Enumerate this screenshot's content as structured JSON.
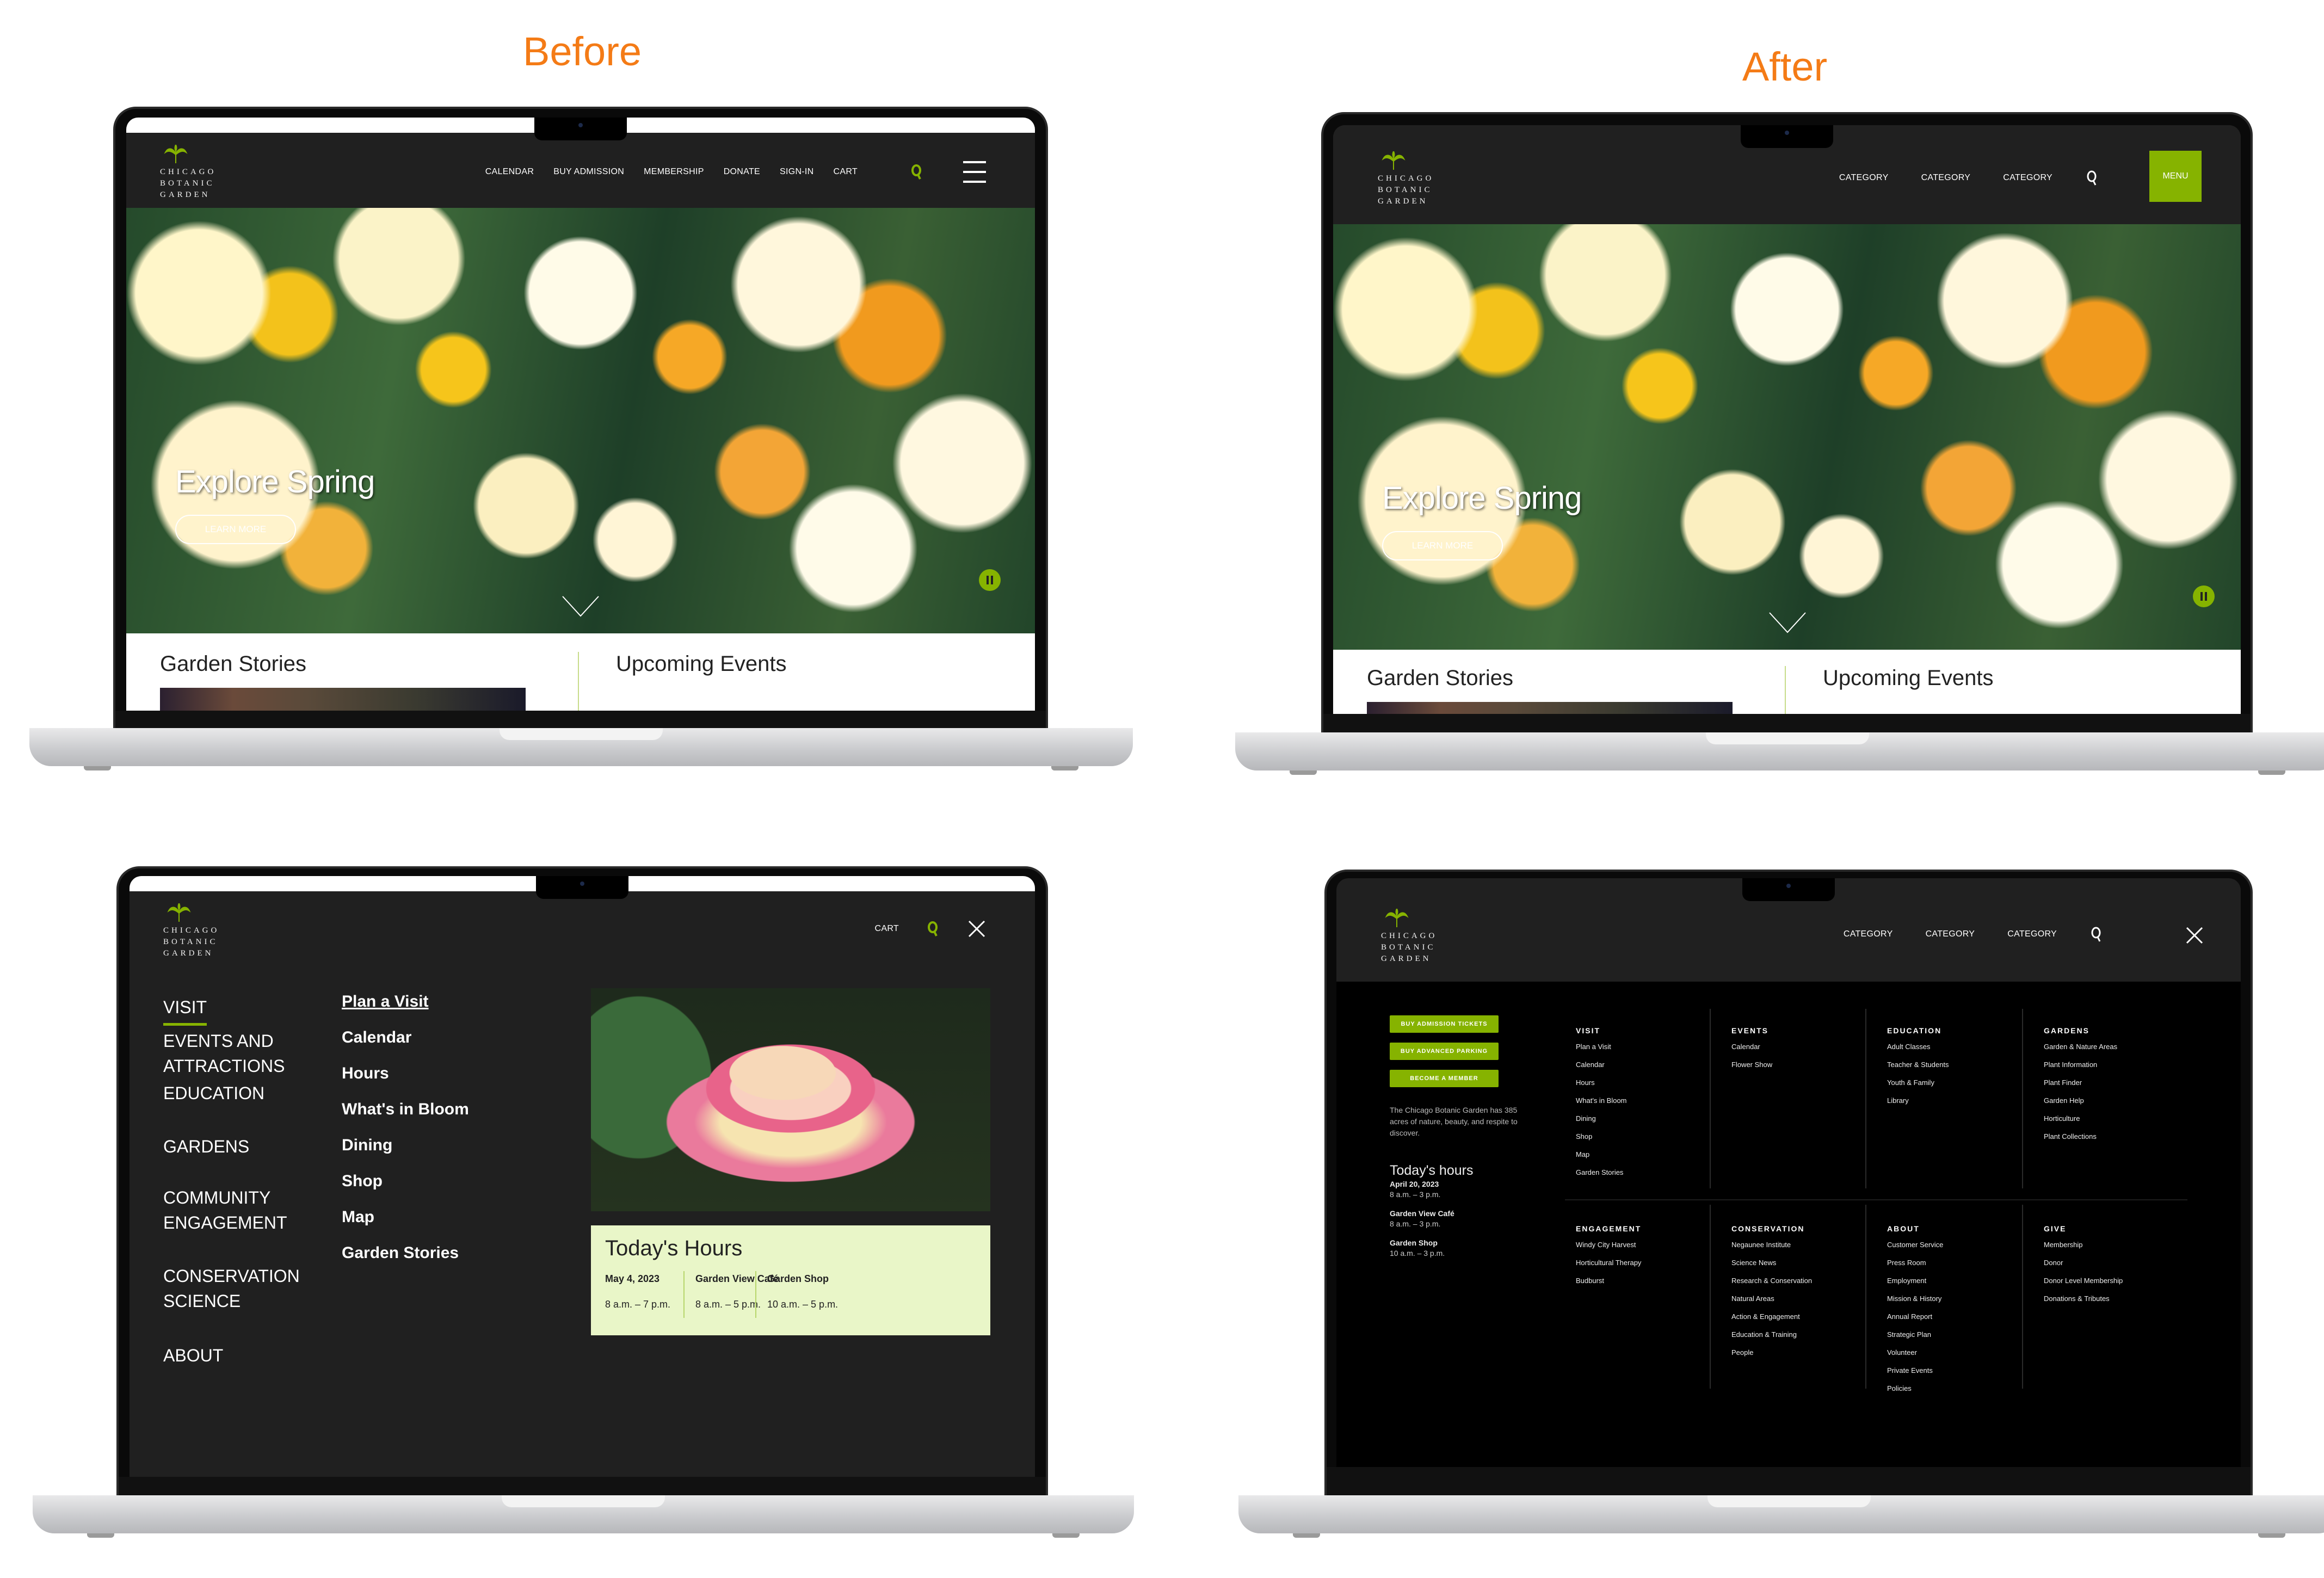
{
  "labels": {
    "before": "Before",
    "after": "After"
  },
  "brand": {
    "line1": "CHICAGO",
    "line2": "BOTANIC",
    "line3": "GARDEN",
    "accent": "#86b300",
    "label_color": "#f47b16"
  },
  "before_home": {
    "nav": [
      "CALENDAR",
      "BUY ADMISSION",
      "MEMBERSHIP",
      "DONATE",
      "SIGN-IN",
      "CART"
    ],
    "hero_title": "Explore Spring",
    "hero_button": "LEARN MORE",
    "section_left": "Garden Stories",
    "section_right": "Upcoming Events"
  },
  "after_home": {
    "nav": [
      "CATEGORY",
      "CATEGORY",
      "CATEGORY"
    ],
    "menu_button": "MENU",
    "hero_title": "Explore Spring",
    "hero_button": "LEARN MORE",
    "section_left": "Garden Stories",
    "section_right": "Upcoming Events"
  },
  "before_menu": {
    "cart": "CART",
    "primary": [
      "VISIT",
      "EVENTS AND\nATTRACTIONS",
      "EDUCATION",
      "GARDENS",
      "COMMUNITY\nENGAGEMENT",
      "CONSERVATION\nSCIENCE",
      "ABOUT"
    ],
    "secondary": [
      "Plan a Visit",
      "Calendar",
      "Hours",
      "What's in Bloom",
      "Dining",
      "Shop",
      "Map",
      "Garden Stories"
    ],
    "hours": {
      "title": "Today's Hours",
      "cols": [
        {
          "label": "May 4, 2023",
          "value": "8 a.m. – 7 p.m."
        },
        {
          "label": "Garden View Café",
          "value": "8 a.m. – 5 p.m."
        },
        {
          "label": "Garden Shop",
          "value": "10 a.m. – 5 p.m."
        }
      ]
    }
  },
  "after_menu": {
    "nav": [
      "CATEGORY",
      "CATEGORY",
      "CATEGORY"
    ],
    "buttons": [
      "BUY ADMISSION TICKETS",
      "BUY ADVANCED PARKING",
      "BECOME A MEMBER"
    ],
    "blurb": "The Chicago Botanic Garden has 385 acres of nature, beauty, and respite to discover.",
    "hours": {
      "title": "Today's hours",
      "rows": [
        {
          "label": "April 20, 2023",
          "value": "8 a.m. – 3 p.m."
        },
        {
          "label": "Garden View Café",
          "value": "8 a.m. – 3 p.m."
        },
        {
          "label": "Garden Shop",
          "value": "10 a.m. – 3 p.m."
        }
      ]
    },
    "columns_top": [
      {
        "head": "VISIT",
        "links": [
          "Plan a Visit",
          "Calendar",
          "Hours",
          "What's in Bloom",
          "Dining",
          "Shop",
          "Map",
          "Garden Stories"
        ]
      },
      {
        "head": "EVENTS",
        "links": [
          "Calendar",
          "Flower Show"
        ]
      },
      {
        "head": "EDUCATION",
        "links": [
          "Adult Classes",
          "Teacher & Students",
          "Youth & Family",
          "Library"
        ]
      },
      {
        "head": "GARDENS",
        "links": [
          "Garden & Nature Areas",
          "Plant Information",
          "Plant Finder",
          "Garden Help",
          "Horticulture",
          "Plant Collections"
        ]
      }
    ],
    "columns_bottom": [
      {
        "head": "ENGAGEMENT",
        "links": [
          "Windy City Harvest",
          "Horticultural Therapy",
          "Budburst"
        ]
      },
      {
        "head": "CONSERVATION",
        "links": [
          "Negaunee Institute",
          "Science News",
          "Research & Conservation",
          "Natural Areas",
          "Action & Engagement",
          "Education & Training",
          "People"
        ]
      },
      {
        "head": "ABOUT",
        "links": [
          "Customer Service",
          "Press Room",
          "Employment",
          "Mission & History",
          "Annual Report",
          "Strategic Plan",
          "Volunteer",
          "Private Events",
          "Policies"
        ]
      },
      {
        "head": "GIVE",
        "links": [
          "Membership",
          "Donor",
          "Donor Level Membership",
          "Donations & Tributes"
        ]
      }
    ]
  }
}
